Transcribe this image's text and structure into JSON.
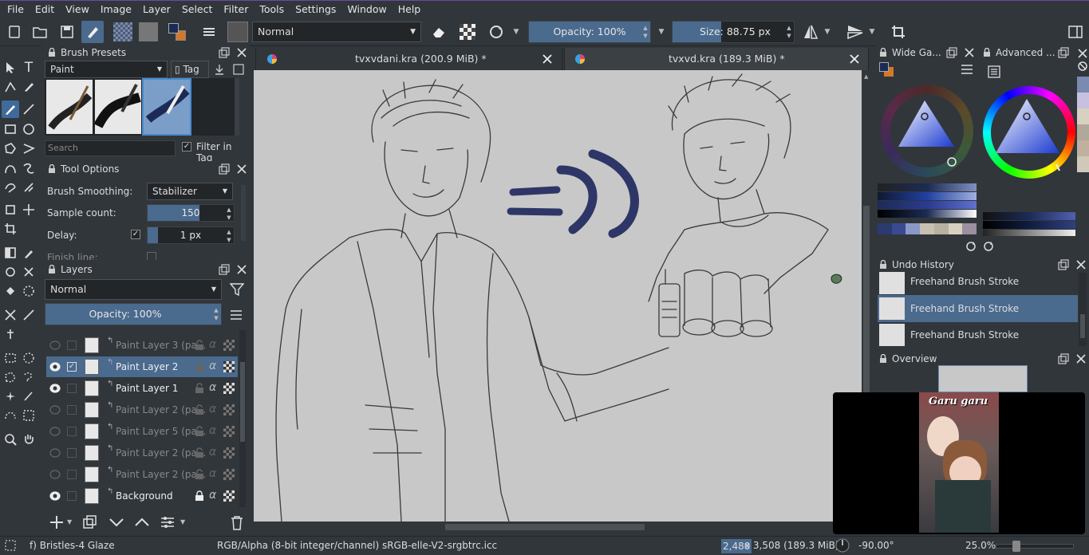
{
  "menu": [
    "File",
    "Edit",
    "View",
    "Image",
    "Layer",
    "Select",
    "Filter",
    "Tools",
    "Settings",
    "Window",
    "Help"
  ],
  "toolbar": {
    "blend_mode": "Normal",
    "opacity_label": "Opacity: 100%",
    "opacity_fraction": 1.0,
    "size_label": "Size:",
    "size_value": "88.75 px"
  },
  "brush_presets": {
    "title": "Brush Presets",
    "tag_combo": "Paint",
    "tag_label": "Tag",
    "search_placeholder": "Search",
    "filter_in_tag": "Filter in Tag"
  },
  "tool_options": {
    "title": "Tool Options",
    "brush_smoothing_label": "Brush Smoothing:",
    "brush_smoothing_value": "Stabilizer",
    "sample_count_label": "Sample count:",
    "sample_count_value": "150",
    "sample_count_fraction": 0.6,
    "delay_label": "Delay:",
    "delay_value": "1 px",
    "finish_line_label": "Finish line:"
  },
  "layers": {
    "title": "Layers",
    "blend_mode": "Normal",
    "opacity_label": "Opacity:  100%",
    "items": [
      {
        "name": "Paint Layer 3 (pa...",
        "visible": false,
        "selected": false
      },
      {
        "name": "Paint Layer 2",
        "visible": true,
        "selected": true
      },
      {
        "name": "Paint Layer 1",
        "visible": true,
        "selected": false
      },
      {
        "name": "Paint Layer 2 (pa...",
        "visible": false,
        "selected": false
      },
      {
        "name": "Paint Layer 5 (pa...",
        "visible": false,
        "selected": false
      },
      {
        "name": "Paint Layer 2 (pa...",
        "visible": false,
        "selected": false
      },
      {
        "name": "Paint Layer 2 (pa...",
        "visible": false,
        "selected": false
      },
      {
        "name": "Background",
        "visible": true,
        "selected": false
      }
    ]
  },
  "tabs": [
    {
      "title": "tvxvdani.kra (200.9 MiB) *",
      "active": false
    },
    {
      "title": "tvxvd.kra (189.3 MiB) *",
      "active": true
    }
  ],
  "right_dockers": {
    "wide_gamut_title": "Wide Ga...",
    "advanced_title": "Advanced ...",
    "undo_title": "Undo History",
    "undo_items": [
      "Freehand Brush Stroke",
      "Freehand Brush Stroke",
      "Freehand Brush Stroke"
    ],
    "overview_title": "Overview"
  },
  "video_overlay": {
    "caption": "Garu garu"
  },
  "statusbar": {
    "brush_name": "f) Bristles-4 Glaze",
    "color_model": "RGB/Alpha (8-bit integer/channel)  sRGB-elle-V2-srgbtrc.icc",
    "dimensions_highlight": "2,480",
    "dimensions_rest": " x 3,508 (189.3 MiB)",
    "rotation": "-90.00°",
    "zoom": "25.0%"
  },
  "colors": {
    "accent": "#4a6a8e",
    "panel": "#31363b",
    "canvas": "#c8c8c8",
    "fg_color": "#1c2b55",
    "bg_color": "#d2782a",
    "paint_stroke": "#2d3666"
  }
}
